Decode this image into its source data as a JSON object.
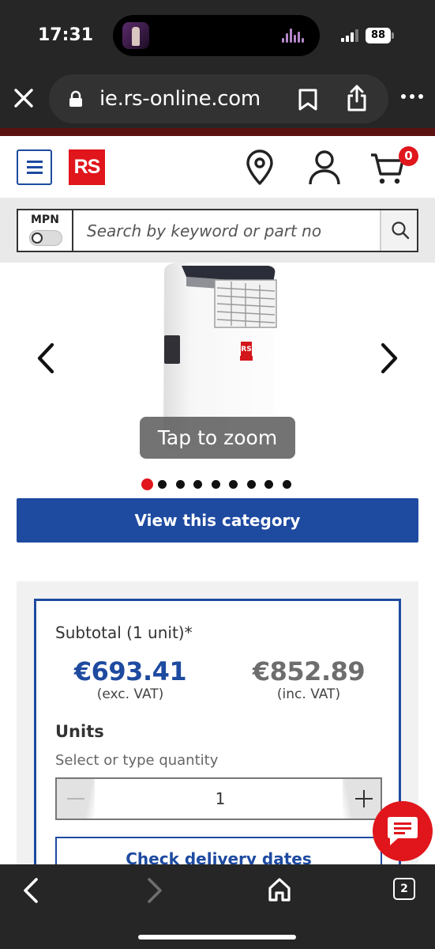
{
  "status_bar": {
    "time": "17:31",
    "battery": "88"
  },
  "browser": {
    "url": "ie.rs-online.com"
  },
  "header": {
    "logo_text": "RS",
    "cart_count": "0"
  },
  "search": {
    "mpn_label": "MPN",
    "placeholder": "Search by keyword or part no"
  },
  "gallery": {
    "zoom_label": "Tap to zoom",
    "total_images": 9,
    "active_index": 0
  },
  "cta": {
    "view_category_label": "View this category"
  },
  "pricing": {
    "subtotal_label": "Subtotal (1 unit)*",
    "price_ex_vat": "€693.41",
    "ex_vat_label": "(exc. VAT)",
    "price_inc_vat": "€852.89",
    "inc_vat_label": "(inc. VAT)"
  },
  "units": {
    "title": "Units",
    "hint": "Select or type quantity",
    "quantity": "1"
  },
  "delivery": {
    "label": "Check delivery dates"
  },
  "toolbar": {
    "tab_count": "2"
  },
  "colors": {
    "brand_red": "#e0161c",
    "brand_blue": "#1e4aa0",
    "chrome_dark": "#262627"
  }
}
